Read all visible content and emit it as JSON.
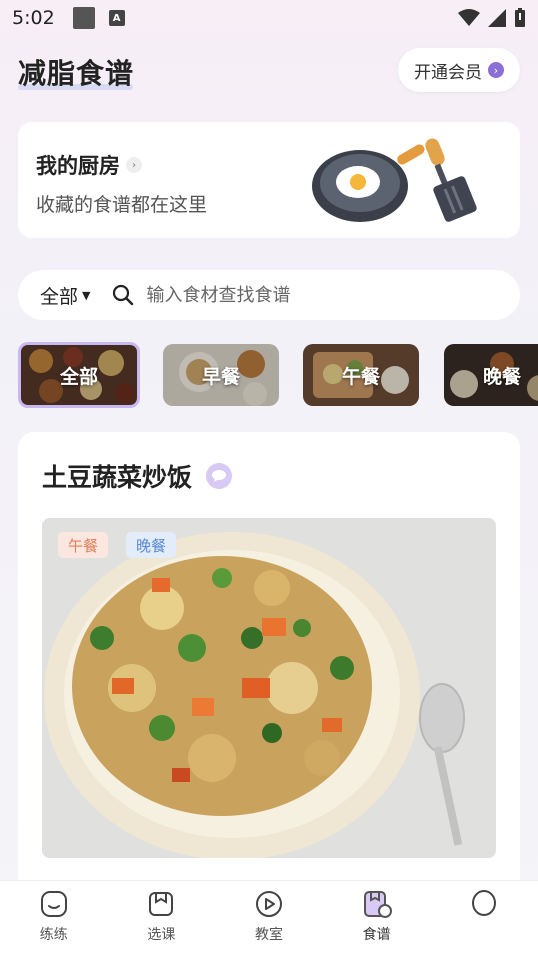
{
  "status_bar": {
    "time": "5:02",
    "notification_letter": "A"
  },
  "header": {
    "title": "减脂食谱",
    "vip_button": "开通会员"
  },
  "kitchen": {
    "title": "我的厨房",
    "subtitle": "收藏的食谱都在这里"
  },
  "search": {
    "filter": "全部",
    "placeholder": "输入食材查找食谱"
  },
  "categories": [
    {
      "label": "全部",
      "active": true
    },
    {
      "label": "早餐",
      "active": false
    },
    {
      "label": "午餐",
      "active": false
    },
    {
      "label": "晚餐",
      "active": false
    }
  ],
  "recipe": {
    "title": "土豆蔬菜炒饭",
    "tags": [
      "午餐",
      "晚餐"
    ]
  },
  "nav": [
    {
      "label": "练练",
      "icon": "smile-icon"
    },
    {
      "label": "选课",
      "icon": "course-icon"
    },
    {
      "label": "教室",
      "icon": "play-icon"
    },
    {
      "label": "食谱",
      "icon": "recipe-icon",
      "active": true
    },
    {
      "label": "",
      "icon": "profile-icon"
    }
  ],
  "colors": {
    "accent": "#8c6fd6",
    "active_border": "#c8b7f0"
  }
}
